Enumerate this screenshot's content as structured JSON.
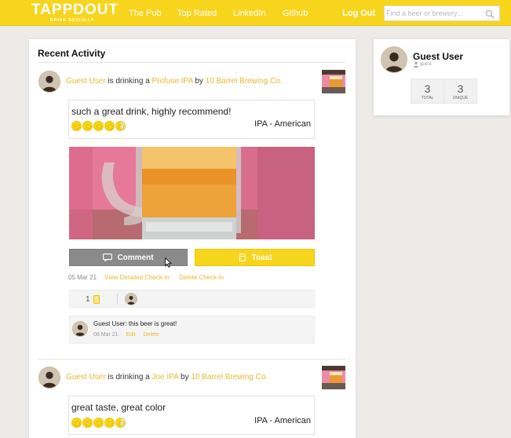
{
  "header": {
    "logo_text": "TAPPDOUT",
    "logo_tagline": "DRINK SOCIALLY",
    "nav": [
      "The Pub",
      "Top Rated",
      "LinkedIn",
      "Github"
    ],
    "logout_label": "Log Out",
    "search_placeholder": "Find a beer or brewery...",
    "brand_color": "#f7d51d"
  },
  "main": {
    "title": "Recent Activity",
    "checkins": [
      {
        "user": "Guest User",
        "verb": "is drinking a",
        "beer": "Profuse IPA",
        "by": "by",
        "brewery": "10 Barrel Brewing Co.",
        "review": "such a great drink, highly recommend!",
        "style": "IPA - American",
        "rating": 4.5,
        "comment_button": "Comment",
        "toast_button": "Toast",
        "date": "05 Mar 21",
        "view_link": "View Detailed Check-in",
        "delete_link": "Delete Check-in",
        "toast_count": "1",
        "comments": [
          {
            "text": "Guest User: this beer is great!",
            "date": "08 Mar 21",
            "edit": "Edit",
            "delete": "Delete"
          }
        ]
      },
      {
        "user": "Guest User",
        "verb": "is drinking a",
        "beer": "Joe IPA",
        "by": "by",
        "brewery": "10 Barrel Brewing Co.",
        "review": "great taste, great color",
        "style": "IPA - American",
        "rating": 4.5
      }
    ]
  },
  "profile": {
    "name": "Guest User",
    "handle": "guest",
    "stats": [
      {
        "value": "3",
        "label": "TOTAL"
      },
      {
        "value": "3",
        "label": "UNIQUE"
      }
    ]
  }
}
